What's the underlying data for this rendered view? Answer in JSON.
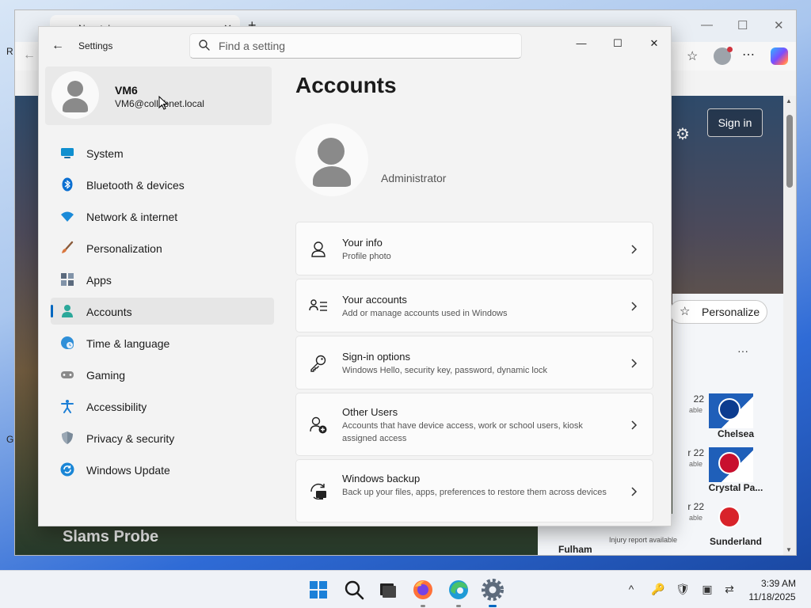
{
  "desktop": {
    "side_glyphs": [
      "R",
      "G"
    ]
  },
  "browser": {
    "tab_title": "New tab",
    "tab_close": "✕",
    "newtab_symbol": "+",
    "window_controls": [
      "—",
      "☐",
      "✕"
    ],
    "background": {
      "signin_label": "Sign in",
      "personalize_label": "Personalize",
      "more_label": "···",
      "teams": [
        {
          "date": "22",
          "sub": "able",
          "name": "Chelsea"
        },
        {
          "date": "r 22",
          "sub": "able",
          "name": "Crystal Pa..."
        },
        {
          "date": "r 22",
          "sub": "able",
          "name": "Sunderland"
        }
      ],
      "fulham_label": "Fulham",
      "injury_label": "Injury report available",
      "headline_fragment": "Slams Probe"
    }
  },
  "settings": {
    "app_title": "Settings",
    "search": {
      "placeholder": "Find a setting",
      "value": ""
    },
    "window_controls": {
      "minimize": "—",
      "maximize": "☐",
      "close": "✕"
    },
    "user": {
      "name": "VM6",
      "email": "VM6@collabnet.local"
    },
    "nav": [
      {
        "label": "System",
        "icon": "monitor-icon",
        "color": "#0f8fcf"
      },
      {
        "label": "Bluetooth & devices",
        "icon": "bluetooth-icon",
        "color": "#0a6fd1"
      },
      {
        "label": "Network & internet",
        "icon": "wifi-icon",
        "color": "#1a8ad8"
      },
      {
        "label": "Personalization",
        "icon": "brush-icon",
        "color": "#d9773f"
      },
      {
        "label": "Apps",
        "icon": "apps-icon",
        "color": "#5b6a7d"
      },
      {
        "label": "Accounts",
        "icon": "person-icon",
        "color": "#2ba89a",
        "selected": true
      },
      {
        "label": "Time & language",
        "icon": "globe-clock-icon",
        "color": "#2f8fd8"
      },
      {
        "label": "Gaming",
        "icon": "gamepad-icon",
        "color": "#7a7a7a"
      },
      {
        "label": "Accessibility",
        "icon": "accessibility-icon",
        "color": "#1c7fd6"
      },
      {
        "label": "Privacy & security",
        "icon": "shield-icon",
        "color": "#7a8a99"
      },
      {
        "label": "Windows Update",
        "icon": "update-icon",
        "color": "#1a86d6"
      }
    ],
    "page_title": "Accounts",
    "profile_role": "Administrator",
    "cards": [
      {
        "title": "Your info",
        "subtitle": "Profile photo",
        "icon": "person-outline-icon"
      },
      {
        "title": "Your accounts",
        "subtitle": "Add or manage accounts used in Windows",
        "icon": "person-list-icon"
      },
      {
        "title": "Sign-in options",
        "subtitle": "Windows Hello, security key, password, dynamic lock",
        "icon": "key-icon"
      },
      {
        "title": "Other Users",
        "subtitle": "Accounts that have device access, work or school users, kiosk assigned access",
        "icon": "person-add-icon"
      },
      {
        "title": "Windows backup",
        "subtitle": "Back up your files, apps, preferences to restore them across devices",
        "icon": "backup-icon"
      }
    ],
    "accent_color": "#0067c0"
  },
  "taskbar": {
    "apps": [
      "start-icon",
      "search-icon",
      "task-view-icon",
      "firefox-icon",
      "edge-icon",
      "settings-app-icon"
    ],
    "tray_overflow": "^",
    "time": "3:39 AM",
    "date": "11/18/2025"
  }
}
